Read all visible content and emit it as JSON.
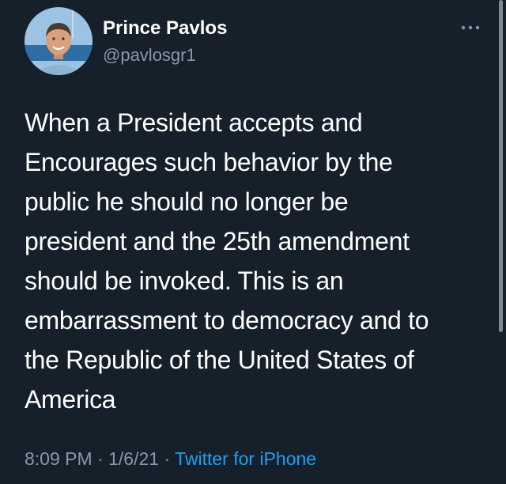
{
  "tweet": {
    "author": {
      "display_name": "Prince Pavlos",
      "handle": "@pavlosgr1",
      "avatar_icon": "profile-photo"
    },
    "more_icon": "more-horizontal-icon",
    "text": "When a President accepts and\nEncourages such behavior by the\npublic he should no longer be\npresident and the 25th amendment\nshould be invoked. This is an\nembarrassment to democracy and to\nthe Republic of the United States of\nAmerica",
    "time": "8:09 PM",
    "separator": " · ",
    "date": "1/6/21",
    "source": "Twitter for iPhone"
  },
  "colors": {
    "background": "#15202b",
    "text_primary": "#ffffff",
    "text_secondary": "#8899a6",
    "link": "#1da1f2"
  }
}
